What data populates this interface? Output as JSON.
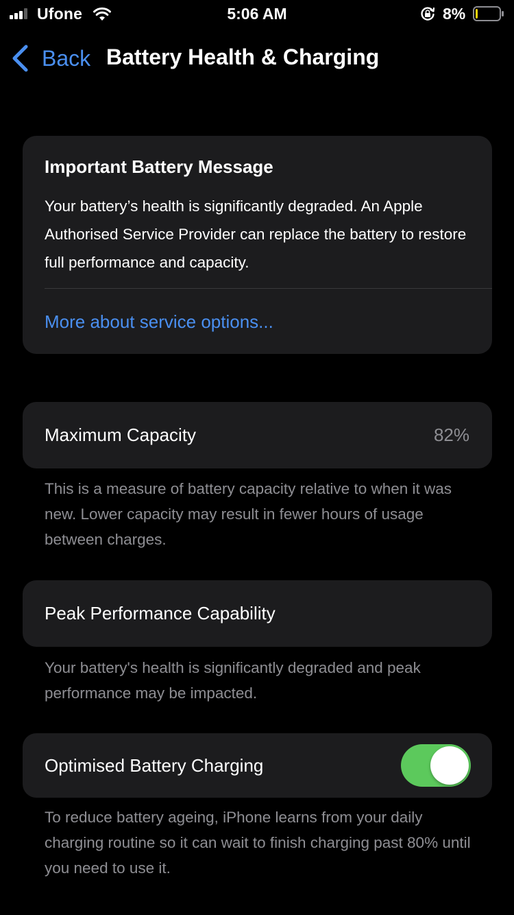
{
  "status_bar": {
    "carrier": "Ufone",
    "time": "5:06 AM",
    "battery_percent": "8%",
    "battery_level": 0.08,
    "signal_bars": 3,
    "icons": [
      "signal-icon",
      "wifi-icon",
      "orientation-lock-icon",
      "battery-icon"
    ]
  },
  "nav": {
    "back_label": "Back",
    "title": "Battery Health & Charging"
  },
  "message_card": {
    "title": "Important Battery Message",
    "body": "Your battery’s health is significantly degraded. An Apple Authorised Service Provider can replace the battery to restore full performance and capacity.",
    "link": "More about service options..."
  },
  "maximum_capacity": {
    "label": "Maximum Capacity",
    "value": "82%",
    "note": "This is a measure of battery capacity relative to when it was new. Lower capacity may result in fewer hours of usage between charges."
  },
  "peak_performance": {
    "label": "Peak Performance Capability",
    "note": "Your battery's health is significantly degraded and peak performance may be impacted."
  },
  "optimised_charging": {
    "label": "Optimised Battery Charging",
    "enabled": true,
    "note": "To reduce battery ageing, iPhone learns from your daily charging routine so it can wait to finish charging past 80% until you need to use it."
  },
  "colors": {
    "background": "#000000",
    "card": "#1c1c1e",
    "accent_blue": "#4a8ff0",
    "toggle_on": "#5cc95c",
    "secondary_text": "#8e8e93",
    "battery_low": "#ffd60a"
  }
}
